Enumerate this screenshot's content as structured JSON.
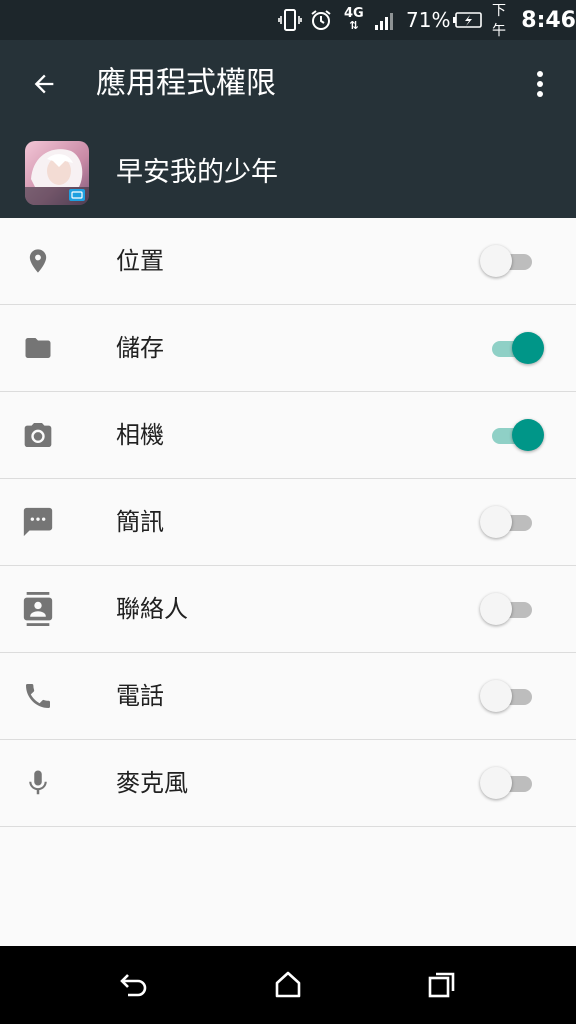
{
  "status_bar": {
    "network": "4G",
    "battery_percent": "71%",
    "time_period": "下午",
    "time": "8:46",
    "icons": [
      "vibrate-icon",
      "alarm-icon",
      "4g-data-icon",
      "signal-icon",
      "battery-charging-icon"
    ]
  },
  "app_bar": {
    "title": "應用程式權限",
    "back_icon": "arrow-back-icon",
    "overflow_icon": "more-vert-icon"
  },
  "app_header": {
    "app_name": "早安我的少年"
  },
  "permissions": [
    {
      "label": "位置",
      "icon": "location-pin-icon",
      "enabled": false
    },
    {
      "label": "儲存",
      "icon": "folder-icon",
      "enabled": true
    },
    {
      "label": "相機",
      "icon": "camera-icon",
      "enabled": true
    },
    {
      "label": "簡訊",
      "icon": "sms-icon",
      "enabled": false
    },
    {
      "label": "聯絡人",
      "icon": "contacts-icon",
      "enabled": false
    },
    {
      "label": "電話",
      "icon": "phone-icon",
      "enabled": false
    },
    {
      "label": "麥克風",
      "icon": "mic-icon",
      "enabled": false
    }
  ],
  "nav_bar": {
    "icons": [
      "nav-back-icon",
      "nav-home-icon",
      "nav-recents-icon"
    ]
  },
  "colors": {
    "app_bar": "#263238",
    "status_bar": "#1d262b",
    "accent": "#009688",
    "icon_gray": "#757575"
  }
}
